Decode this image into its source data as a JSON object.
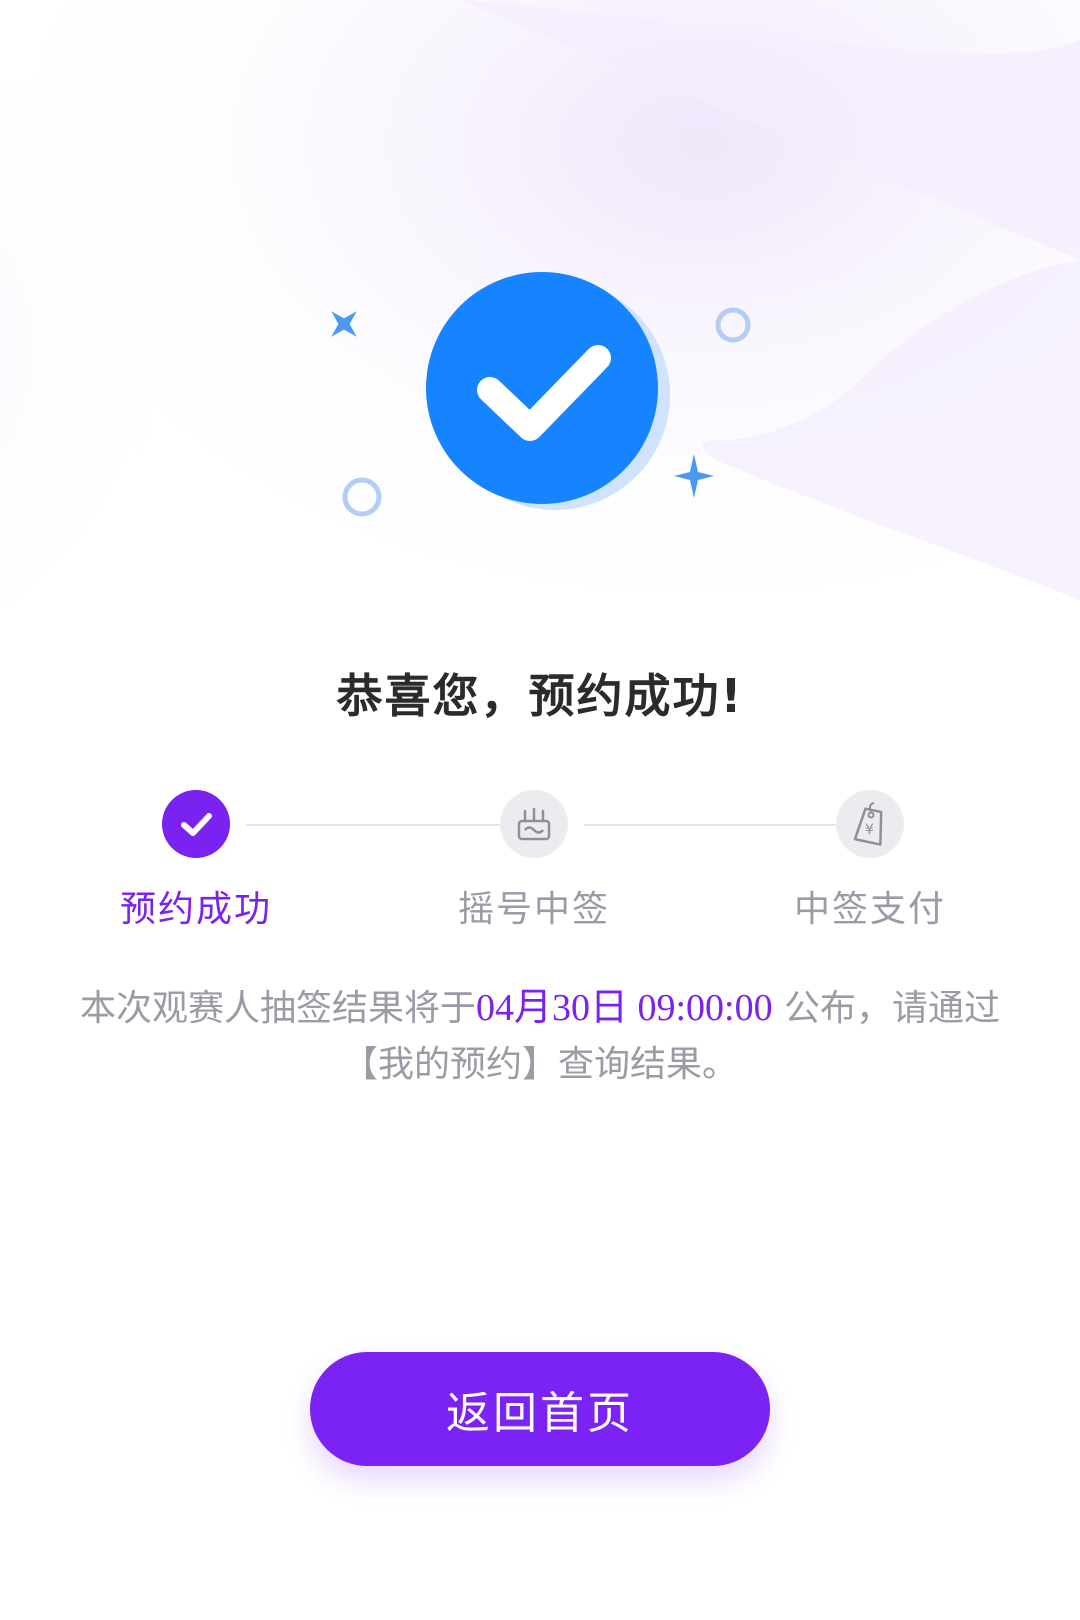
{
  "title": "恭喜您，预约成功!",
  "steps": [
    {
      "label": "预约成功",
      "state": "done"
    },
    {
      "label": "摇号中签",
      "state": "pending"
    },
    {
      "label": "中签支付",
      "state": "pending"
    }
  ],
  "info": {
    "prefix": "本次观赛人抽签结果将于",
    "datetime": "04月30日 09:00:00",
    "suffix": " 公布，请通过【我的预约】查询结果。"
  },
  "button": {
    "label": "返回首页"
  },
  "colors": {
    "accent": "#7a22f0",
    "success_badge": "#1684ff",
    "muted_text": "#9b9ba6",
    "title_text": "#2b2b2b"
  },
  "icons": [
    "check-circle-icon",
    "sparkle-icon",
    "ring-icon",
    "lottery-box-icon",
    "price-tag-icon"
  ]
}
